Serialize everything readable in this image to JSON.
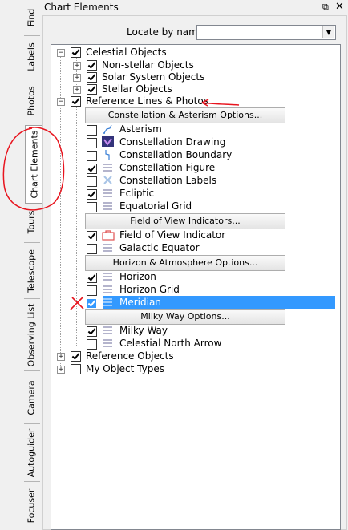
{
  "tabs": [
    {
      "label": "Find",
      "active": false
    },
    {
      "label": "Labels",
      "active": false
    },
    {
      "label": "Photos",
      "active": false
    },
    {
      "label": "Chart Elements",
      "active": true
    },
    {
      "label": "Tours",
      "active": false
    },
    {
      "label": "Telescope",
      "active": false
    },
    {
      "label": "Observing List",
      "active": false
    },
    {
      "label": "Camera",
      "active": false
    },
    {
      "label": "Autoguider",
      "active": false
    },
    {
      "label": "Focuser",
      "active": false
    }
  ],
  "header": {
    "title": "Chart Elements",
    "float_icon": "float-window-icon",
    "close_icon": "close-icon"
  },
  "locate": {
    "label": "Locate by name:",
    "value": ""
  },
  "tree": {
    "celestial": {
      "label": "Celestial Objects",
      "checked": true
    },
    "nonstellar": {
      "label": "Non-stellar Objects",
      "checked": true
    },
    "solar": {
      "label": "Solar System Objects",
      "checked": true
    },
    "stellar": {
      "label": "Stellar Objects",
      "checked": true
    },
    "reflines": {
      "label": "Reference Lines & Photos",
      "checked": true
    },
    "btn_constellation": "Constellation & Asterism Options...",
    "asterism": {
      "label": "Asterism",
      "checked": false
    },
    "const_drawing": {
      "label": "Constellation Drawing",
      "checked": false
    },
    "const_boundary": {
      "label": "Constellation Boundary",
      "checked": false
    },
    "const_figure": {
      "label": "Constellation Figure",
      "checked": true
    },
    "const_labels": {
      "label": "Constellation Labels",
      "checked": false
    },
    "ecliptic": {
      "label": "Ecliptic",
      "checked": true
    },
    "eq_grid": {
      "label": "Equatorial Grid",
      "checked": false
    },
    "btn_fov": "Field of View Indicators...",
    "fov_indicator": {
      "label": "Field of View Indicator",
      "checked": true
    },
    "galactic_eq": {
      "label": "Galactic Equator",
      "checked": false
    },
    "btn_horizon": "Horizon & Atmosphere Options...",
    "horizon": {
      "label": "Horizon",
      "checked": true
    },
    "horizon_grid": {
      "label": "Horizon Grid",
      "checked": false
    },
    "meridian": {
      "label": "Meridian",
      "checked": true,
      "selected": true
    },
    "btn_milkyway": "Milky Way Options...",
    "milky_way": {
      "label": "Milky Way",
      "checked": true
    },
    "north_arrow": {
      "label": "Celestial North Arrow",
      "checked": false
    },
    "refobjects": {
      "label": "Reference Objects",
      "checked": true
    },
    "myobjects": {
      "label": "My Object Types",
      "checked": false
    }
  },
  "colors": {
    "selection": "#3399ff",
    "annotation": "#e8141e",
    "window_bg": "#f0f0f0"
  }
}
